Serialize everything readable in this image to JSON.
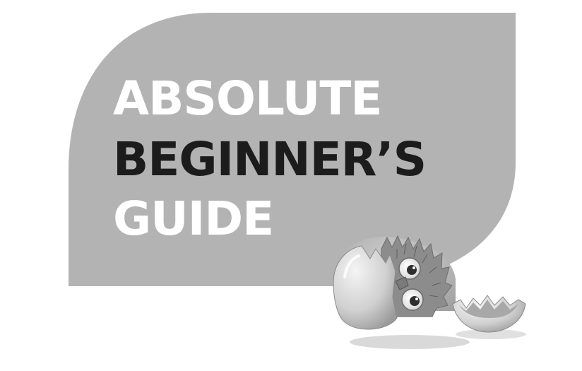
{
  "title": {
    "lines": [
      "ABSOLUTE",
      "BEGINNER’S",
      "GUIDE"
    ]
  },
  "colors": {
    "background": "#ffffff",
    "panel": "#b3b3b3",
    "light_text": "#ffffff",
    "dark_text": "#1c1c1c",
    "egg_shell": "#d2d2d2",
    "chick_feathers": "#8c8c8c"
  },
  "icons": [
    "hatching-chick-icon",
    "eggshell-fragment-icon"
  ]
}
